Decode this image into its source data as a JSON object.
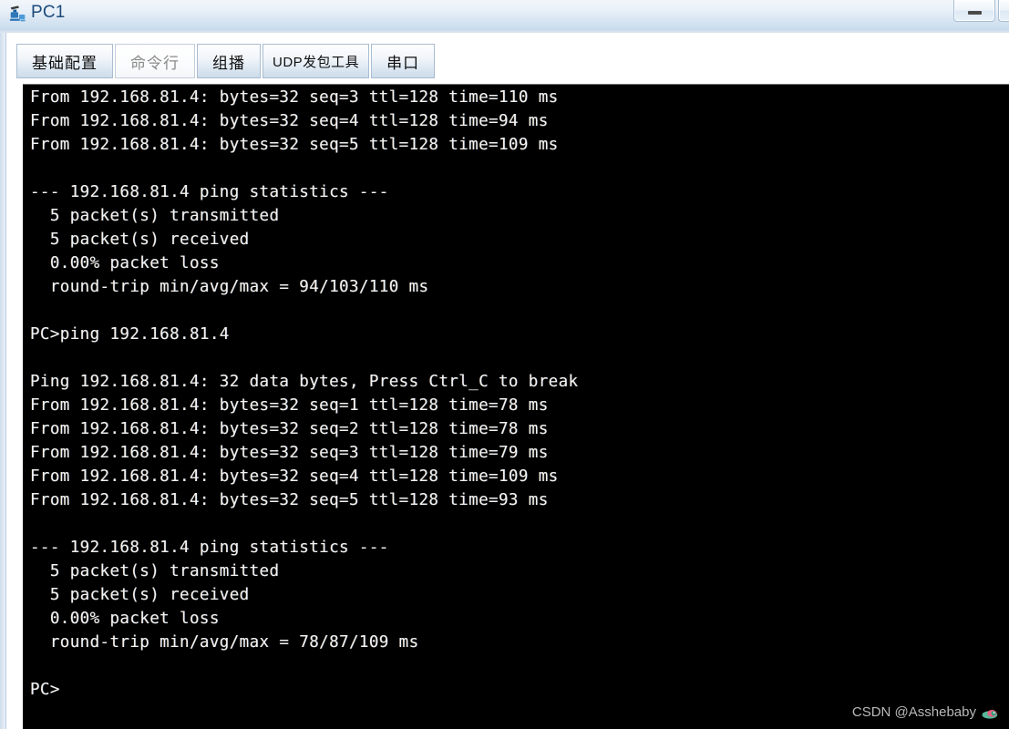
{
  "window": {
    "title": "PC1",
    "icon": "pc-device-icon",
    "minimize_label": "–",
    "maximize_label": "□"
  },
  "tabs": [
    {
      "label": "基础配置",
      "name": "tab-basic-config",
      "active": false
    },
    {
      "label": "命令行",
      "name": "tab-command-line",
      "active": true
    },
    {
      "label": "组播",
      "name": "tab-multicast",
      "active": false
    },
    {
      "label": "UDP发包工具",
      "name": "tab-udp-tool",
      "active": false
    },
    {
      "label": "串口",
      "name": "tab-serial-port",
      "active": false
    }
  ],
  "terminal": {
    "target_ip": "192.168.81.4",
    "lines": [
      "From 192.168.81.4: bytes=32 seq=3 ttl=128 time=110 ms",
      "From 192.168.81.4: bytes=32 seq=4 ttl=128 time=94 ms",
      "From 192.168.81.4: bytes=32 seq=5 ttl=128 time=109 ms",
      "",
      "--- 192.168.81.4 ping statistics ---",
      "  5 packet(s) transmitted",
      "  5 packet(s) received",
      "  0.00% packet loss",
      "  round-trip min/avg/max = 94/103/110 ms",
      "",
      "PC>ping 192.168.81.4",
      "",
      "Ping 192.168.81.4: 32 data bytes, Press Ctrl_C to break",
      "From 192.168.81.4: bytes=32 seq=1 ttl=128 time=78 ms",
      "From 192.168.81.4: bytes=32 seq=2 ttl=128 time=78 ms",
      "From 192.168.81.4: bytes=32 seq=3 ttl=128 time=79 ms",
      "From 192.168.81.4: bytes=32 seq=4 ttl=128 time=109 ms",
      "From 192.168.81.4: bytes=32 seq=5 ttl=128 time=93 ms",
      "",
      "--- 192.168.81.4 ping statistics ---",
      "  5 packet(s) transmitted",
      "  5 packet(s) received",
      "  0.00% packet loss",
      "  round-trip min/avg/max = 78/87/109 ms",
      "",
      "PC>"
    ],
    "prompt": "PC>"
  },
  "watermark": {
    "text": "CSDN @Asshebaby"
  },
  "colors": {
    "terminal_bg": "#000000",
    "terminal_fg": "#f2f2f2",
    "title_fg": "#1c4a7a",
    "accent": "#2e77b8"
  }
}
